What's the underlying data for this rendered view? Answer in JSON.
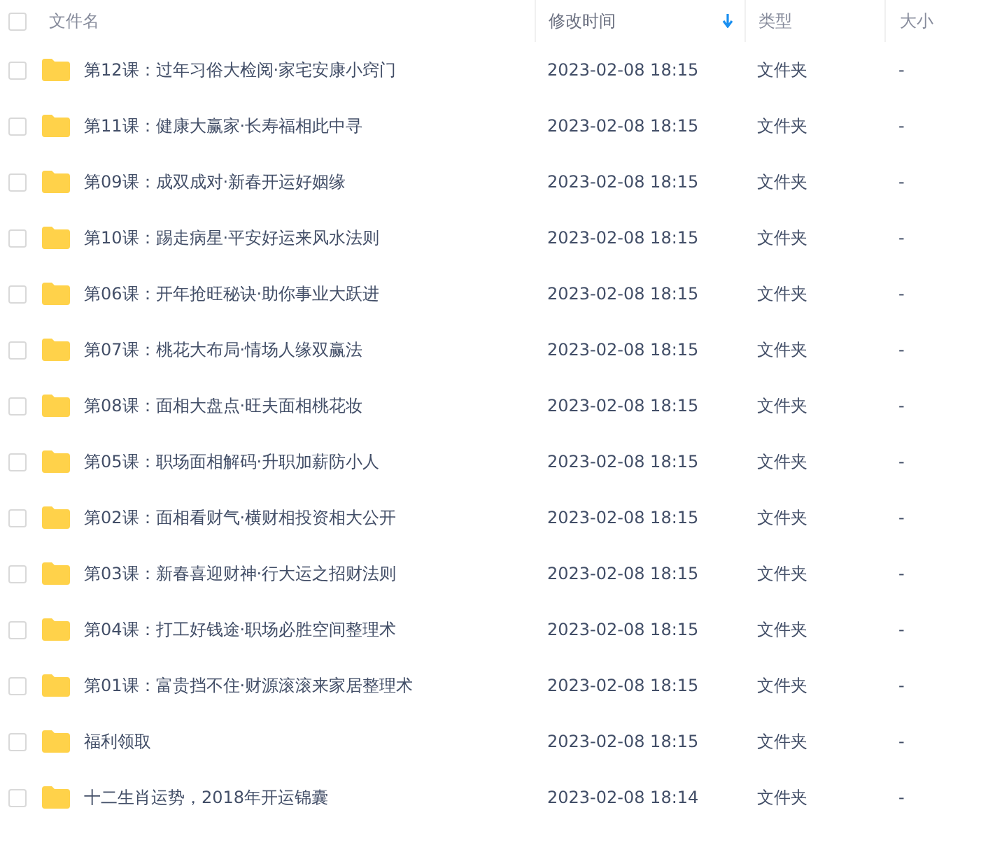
{
  "table": {
    "select_all": {
      "checked": false
    },
    "columns": [
      {
        "label": "文件名",
        "sorted": false
      },
      {
        "label": "修改时间",
        "sorted": true
      },
      {
        "label": "类型",
        "sorted": false
      },
      {
        "label": "大小",
        "sorted": false
      }
    ],
    "rows": [
      {
        "name": "第12课：过年习俗大检阅·家宅安康小窍门",
        "modified": "2023-02-08 18:15",
        "type": "文件夹",
        "size": "-",
        "checked": false
      },
      {
        "name": "第11课：健康大赢家·长寿福相此中寻",
        "modified": "2023-02-08 18:15",
        "type": "文件夹",
        "size": "-",
        "checked": false
      },
      {
        "name": "第09课：成双成对·新春开运好姻缘",
        "modified": "2023-02-08 18:15",
        "type": "文件夹",
        "size": "-",
        "checked": false
      },
      {
        "name": "第10课：踢走病星·平安好运来风水法则",
        "modified": "2023-02-08 18:15",
        "type": "文件夹",
        "size": "-",
        "checked": false
      },
      {
        "name": "第06课：开年抢旺秘诀·助你事业大跃进",
        "modified": "2023-02-08 18:15",
        "type": "文件夹",
        "size": "-",
        "checked": false
      },
      {
        "name": "第07课：桃花大布局·情场人缘双赢法",
        "modified": "2023-02-08 18:15",
        "type": "文件夹",
        "size": "-",
        "checked": false
      },
      {
        "name": "第08课：面相大盘点·旺夫面相桃花妆",
        "modified": "2023-02-08 18:15",
        "type": "文件夹",
        "size": "-",
        "checked": false
      },
      {
        "name": "第05课：职场面相解码·升职加薪防小人",
        "modified": "2023-02-08 18:15",
        "type": "文件夹",
        "size": "-",
        "checked": false
      },
      {
        "name": "第02课：面相看财气·横财相投资相大公开",
        "modified": "2023-02-08 18:15",
        "type": "文件夹",
        "size": "-",
        "checked": false
      },
      {
        "name": "第03课：新春喜迎财神·行大运之招财法则",
        "modified": "2023-02-08 18:15",
        "type": "文件夹",
        "size": "-",
        "checked": false
      },
      {
        "name": "第04课：打工好钱途·职场必胜空间整理术",
        "modified": "2023-02-08 18:15",
        "type": "文件夹",
        "size": "-",
        "checked": false
      },
      {
        "name": "第01课：富贵挡不住·财源滚滚来家居整理术",
        "modified": "2023-02-08 18:15",
        "type": "文件夹",
        "size": "-",
        "checked": false
      },
      {
        "name": "福利领取",
        "modified": "2023-02-08 18:15",
        "type": "文件夹",
        "size": "-",
        "checked": false
      },
      {
        "name": "十二生肖运势，2018年开运锦囊",
        "modified": "2023-02-08 18:14",
        "type": "文件夹",
        "size": "-",
        "checked": false
      }
    ]
  }
}
